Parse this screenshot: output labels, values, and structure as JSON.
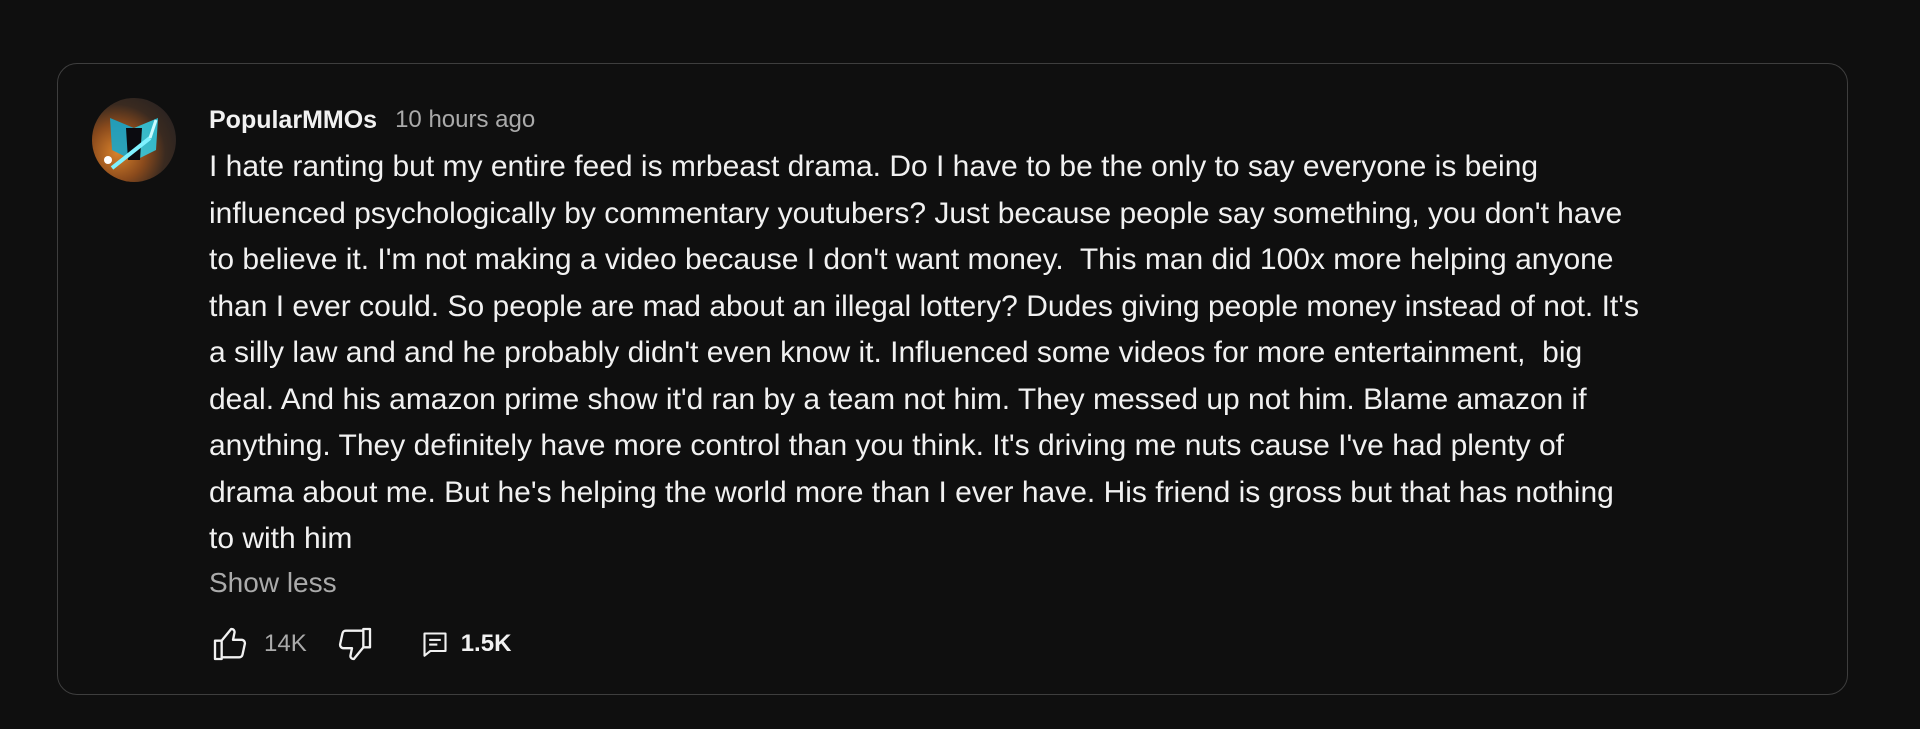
{
  "comment": {
    "author": "PopularMMOs",
    "timestamp": "10 hours ago",
    "text": "I hate ranting but my entire feed is mrbeast drama. Do I have to be the only to say everyone is being\ninfluenced psychologically by commentary youtubers? Just because people say something, you don't have\nto believe it. I'm not making a video because I don't want money.  This man did 100x more helping anyone\nthan I ever could. So people are mad about an illegal lottery? Dudes giving people money instead of not. It's\na silly law and and he probably didn't even know it. Influenced some videos for more entertainment,  big\ndeal. And his amazon prime show it'd ran by a team not him. They messed up not him. Blame amazon if\nanything. They definitely have more control than you think. It's driving me nuts cause I've had plenty of\ndrama about me. But he's helping the world more than I ever have. His friend is gross but that has nothing\nto with him",
    "show_less_label": "Show less",
    "like_count": "14K",
    "reply_count": "1.5K"
  },
  "icons": {
    "like": "thumbs-up-icon",
    "dislike": "thumbs-down-icon",
    "replies": "comment-icon"
  },
  "colors": {
    "background": "#0f0f0f",
    "card_border": "#3e3e3e",
    "text_primary": "#f1f1f1",
    "text_secondary": "#aaaaaa"
  }
}
